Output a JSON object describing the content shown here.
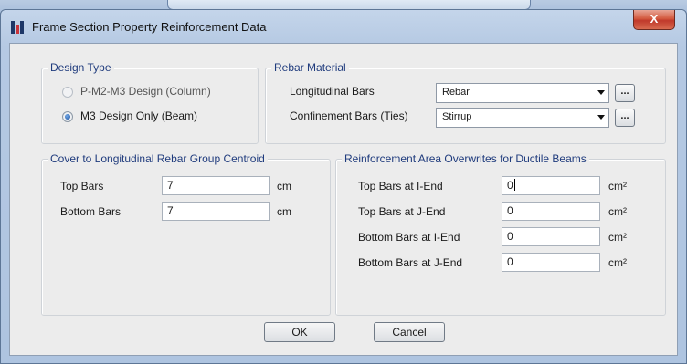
{
  "window": {
    "title": "Frame Section Property Reinforcement Data",
    "close_label": "X"
  },
  "design_type": {
    "title": "Design Type",
    "options": [
      {
        "label": "P-M2-M3 Design  (Column)",
        "checked": false,
        "enabled": false
      },
      {
        "label": "M3 Design Only  (Beam)",
        "checked": true,
        "enabled": true
      }
    ]
  },
  "rebar_material": {
    "title": "Rebar Material",
    "longitudinal_label": "Longitudinal Bars",
    "longitudinal_value": "Rebar",
    "confinement_label": "Confinement Bars (Ties)",
    "confinement_value": "Stirrup",
    "more_label": "..."
  },
  "cover": {
    "title": "Cover to Longitudinal Rebar Group Centroid",
    "top_label": "Top Bars",
    "top_value": "7",
    "bottom_label": "Bottom  Bars",
    "bottom_value": "7",
    "unit": "cm"
  },
  "overwrites": {
    "title": "Reinforcement Area Overwrites for Ductile Beams",
    "unit": "cm²",
    "rows": [
      {
        "label": "Top Bars at I-End",
        "value": "0"
      },
      {
        "label": "Top Bars at J-End",
        "value": "0"
      },
      {
        "label": "Bottom Bars at I-End",
        "value": "0"
      },
      {
        "label": "Bottom Bars at J-End",
        "value": "0"
      }
    ]
  },
  "buttons": {
    "ok": "OK",
    "cancel": "Cancel"
  }
}
